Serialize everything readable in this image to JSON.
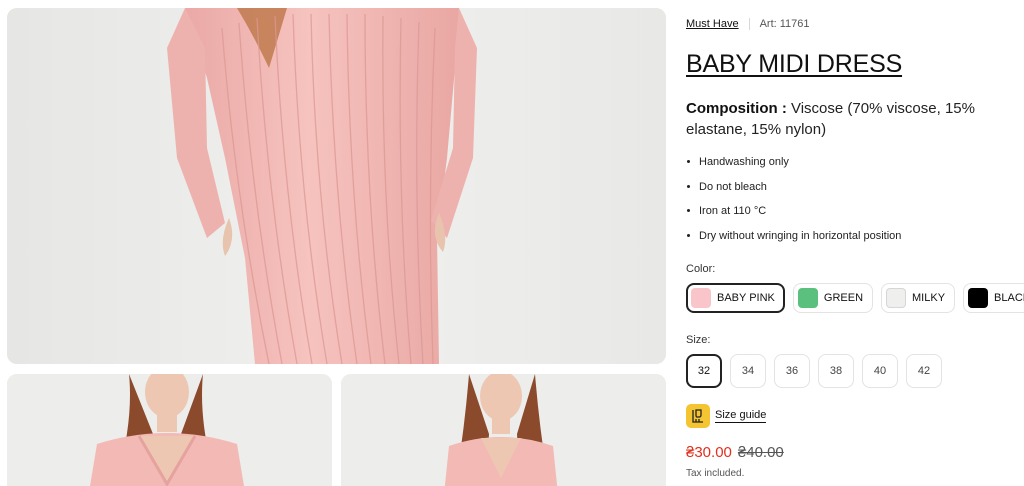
{
  "product": {
    "collection_link": "Must Have",
    "article": "Art: 11761",
    "name": "BABY MIDI DRESS",
    "composition_label": "Composition :",
    "composition_value": " Viscose (70% viscose, 15% elastane, 15% nylon)"
  },
  "care": [
    "Handwashing only",
    "Do not bleach",
    "Iron at 110 °C",
    "Dry without wringing in horizontal position"
  ],
  "color": {
    "label": "Color:",
    "selected": "BABY PINK",
    "options": [
      {
        "name": "BABY PINK",
        "hex": "#f9c5cb"
      },
      {
        "name": "GREEN",
        "hex": "#5bbf7d"
      },
      {
        "name": "MILKY",
        "hex": "#efefed"
      },
      {
        "name": "BLACK",
        "hex": "#000000"
      }
    ]
  },
  "size": {
    "label": "Size:",
    "selected": "32",
    "options": [
      "32",
      "34",
      "36",
      "38",
      "40",
      "42"
    ]
  },
  "size_guide": {
    "label": "Size guide",
    "icon": "size-guide-icon"
  },
  "price": {
    "current": "₴30.00",
    "old": "₴40.00",
    "tax_note": "Tax included."
  },
  "gallery": {
    "dress_color": "#f3b9b5",
    "background": "#ececea"
  }
}
